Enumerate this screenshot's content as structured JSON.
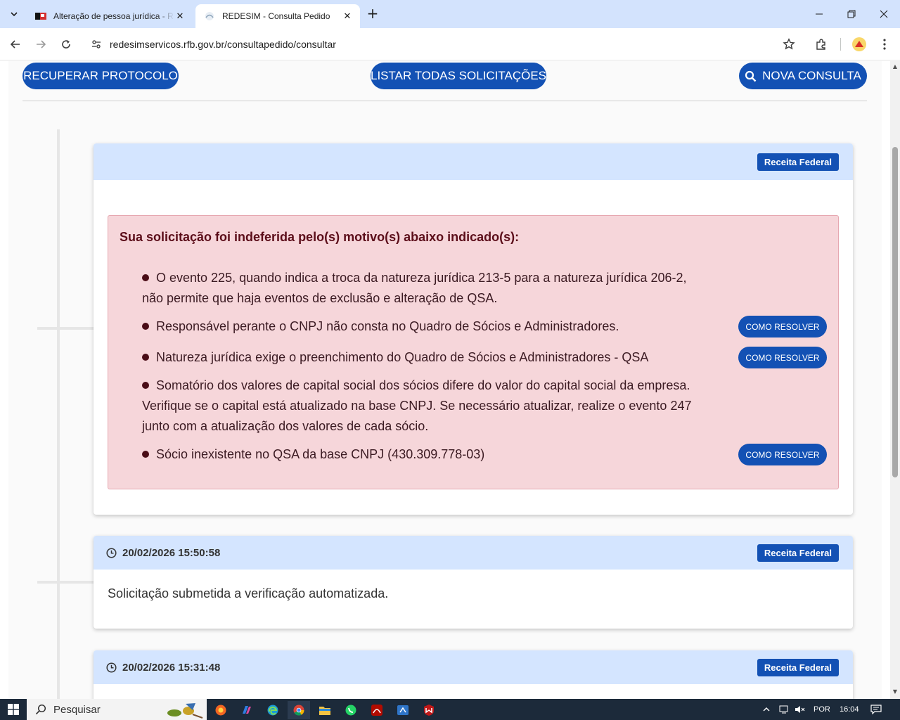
{
  "browser": {
    "tabs": [
      {
        "title": "Alteração de pessoa jurídica - R",
        "active": false
      },
      {
        "title": "REDESIM - Consulta Pedido",
        "active": true
      }
    ],
    "url": "redesimservicos.rfb.gov.br/consultapedido/consultar"
  },
  "actions": {
    "recover": "RECUPERAR PROTOCOLO",
    "list_all": "LISTAR TODAS SOLICITAÇÕES",
    "new_query": "NOVA CONSULTA"
  },
  "cards": [
    {
      "badge": "Receita Federal",
      "alert_title": "Sua solicitação foi indeferida pelo(s) motivo(s) abaixo indicado(s):",
      "reasons": [
        {
          "text": "O evento 225, quando indica a troca da natureza jurídica 213-5 para a natureza jurídica 206-2, não permite que haja eventos de exclusão e alteração de QSA.",
          "button": ""
        },
        {
          "text": "Responsável perante o CNPJ não consta no Quadro de Sócios e Administradores.",
          "button": "COMO RESOLVER"
        },
        {
          "text": "Natureza jurídica exige o preenchimento do Quadro de Sócios e Administradores - QSA",
          "button": "COMO RESOLVER"
        },
        {
          "text": "Somatório dos valores de capital social dos sócios difere do valor do capital social da empresa. Verifique se o capital está atualizado na base CNPJ. Se necessário atualizar, realize o evento 247 junto com a atualização dos valores de cada sócio.",
          "button": ""
        },
        {
          "text": "Sócio inexistente no QSA da base CNPJ (430.309.778-03)",
          "button": "COMO RESOLVER"
        }
      ]
    },
    {
      "date": "20/02/2026 15:50:58",
      "badge": "Receita Federal",
      "body": "Solicitação submetida a verificação automatizada."
    },
    {
      "date": "20/02/2026 15:31:48",
      "badge": "Receita Federal"
    }
  ],
  "taskbar": {
    "search_placeholder": "Pesquisar",
    "language": "POR",
    "time": "16:04"
  },
  "colors": {
    "primary": "#1351b4",
    "card_header": "#d4e5ff",
    "alert_bg": "#f6d6da",
    "alert_text": "#5c0e1a"
  }
}
